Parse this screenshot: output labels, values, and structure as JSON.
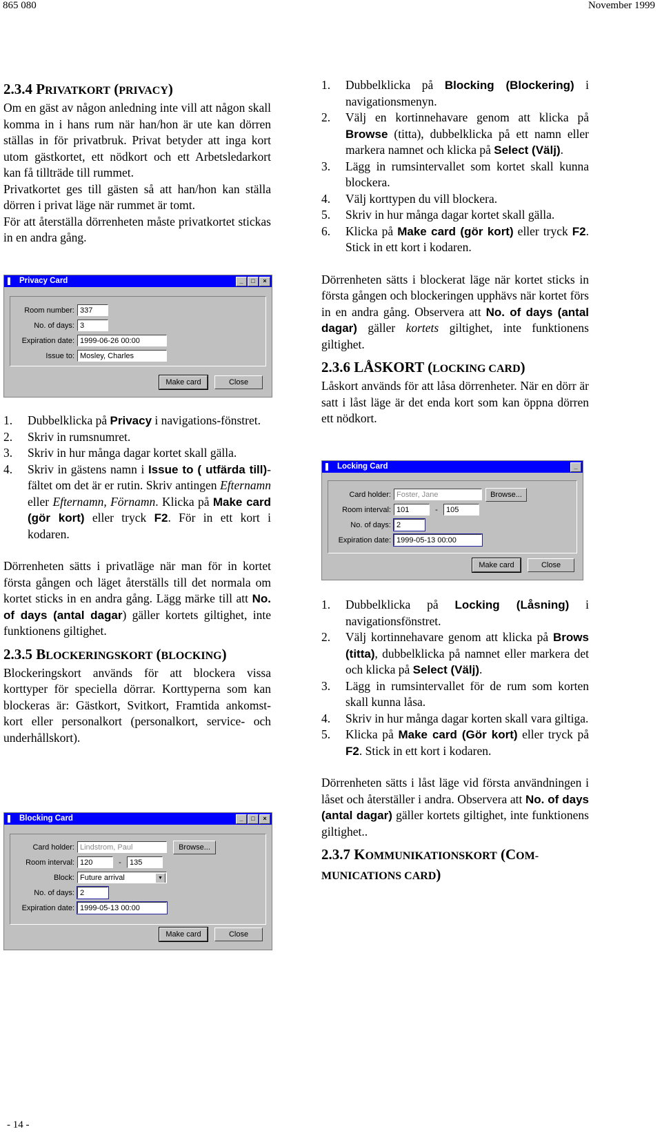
{
  "header": {
    "left": "865 080",
    "right": "November 1999"
  },
  "footer": {
    "page": "- 14 -"
  },
  "privacy_section": {
    "heading_num": "2.3.4 ",
    "heading_big1": "P",
    "heading_small1": "RIVATKORT",
    "heading_paren_open": " (",
    "heading_small2": "PRIVACY",
    "heading_paren_close": ")",
    "para1": "Om en gäst av någon anledning inte vill att någon skall komma in i hans rum när han/hon är ute kan dörren ställas in för privatbruk. Privat betyder att inga kort utom gästkortet, ett nödkort och ett Arbetsledarkort kan få tillträde till rummet.",
    "para2": "Privatkortet ges till gästen så att han/hon kan ställa dörren i privat läge när rummet är tomt.",
    "para3": "För att återställa dörrenheten måste privatkortet stickas in en andra gång.",
    "steps": [
      {
        "n": "1.",
        "a": "Dubbelklicka på ",
        "b": "Privacy",
        "c": " i navigations-fönstret."
      },
      {
        "n": "2.",
        "a": "Skriv in rumsnumret."
      },
      {
        "n": "3.",
        "a": "Skriv in hur många dagar kortet skall gälla."
      },
      {
        "n": "4.",
        "a": "Skriv in gästens namn i ",
        "b": "Issue to ( utfärda till)",
        "c": "-fältet om det är er rutin. Skriv antingen ",
        "i1": "Efternamn",
        "d": " eller ",
        "i2": "Efternamn, Förnamn",
        "e": ". Klicka på ",
        "f": "Make card (gör kort)",
        "g": " eller tryck ",
        "h": "F2",
        "j": ". För in ett kort i kodaren."
      }
    ],
    "note_a": "Dörrenheten sätts i privatläge när man för in kortet första gången och läget återställs till det normala om kortet sticks in en andra gång. Lägg märke till att ",
    "note_b": "No. of days (antal dagar",
    "note_c": ") gäller kortets giltighet, inte funktionens giltighet."
  },
  "privacy_dialog": {
    "title": "Privacy Card",
    "fields": {
      "room_number_label": "Room number:",
      "room_number": "337",
      "days_label": "No. of days:",
      "days": "3",
      "expiration_label": "Expiration date:",
      "expiration": "1999-06-26 00:00",
      "issue_label": "Issue to:",
      "issue": "Mosley, Charles"
    },
    "make_card": "Make card",
    "close": "Close"
  },
  "blocking_section": {
    "heading_num": "2.3.5 ",
    "heading_big1": "B",
    "heading_small1": "LOCKERINGSKORT",
    "heading_paren_open": " (",
    "heading_small2": "BLOCKING",
    "heading_paren_close": ")",
    "para": "Blockeringskort används för att blockera vissa korttyper för speciella dörrar. Korttyperna som kan blockeras är: Gästkort, Svitkort, Framtida ankomst-kort eller personalkort (personalkort, service- och underhållskort).",
    "steps": [
      {
        "n": "1.",
        "a": "Dubbelklicka på ",
        "b": "Blocking (Blockering)",
        "c": " i navigationsmenyn."
      },
      {
        "n": "2.",
        "a": "Välj en kortinnehavare genom att klicka på ",
        "b": "Browse",
        "c": " (titta), dubbelklicka på ett namn eller markera namnet och klicka på ",
        "d": "Select (Välj)",
        "e": "."
      },
      {
        "n": "3.",
        "a": "Lägg in rumsintervallet som kortet skall kunna blockera."
      },
      {
        "n": "4.",
        "a": "Välj korttypen du vill blockera."
      },
      {
        "n": "5.",
        "a": "Skriv in hur många dagar kortet skall gälla."
      },
      {
        "n": "6.",
        "a": "Klicka på ",
        "b": "Make card (gör kort)",
        "c": " eller tryck ",
        "d": "F2",
        "e": ". Stick in ett kort i kodaren."
      }
    ],
    "note_a": "Dörrenheten sätts i blockerat läge när kortet sticks in första gången och blockeringen upphävs när kortet förs in en andra gång. Observera att ",
    "note_b": "No. of days (antal dagar)",
    "note_c": " gäller ",
    "note_i": "kortets",
    "note_d": " giltighet, inte funktionens giltighet."
  },
  "blocking_dialog": {
    "title": "Blocking Card",
    "fields": {
      "holder_label": "Card holder:",
      "holder": "Lindstrom, Paul",
      "interval_label": "Room interval:",
      "from": "120",
      "dash": "-",
      "to": "135",
      "block_label": "Block:",
      "block": "Future arrival",
      "days_label": "No. of days:",
      "days": "2",
      "expiration_label": "Expiration date:",
      "expiration": "1999-05-13 00:00"
    },
    "browse": "Browse...",
    "make_card": "Make card",
    "close": "Close"
  },
  "locking_section": {
    "heading_num": "2.3.6 ",
    "heading_main": "LÅSKORT",
    "heading_paren_open": " (",
    "heading_small": "LOCKING CARD",
    "heading_paren_close": ")",
    "para": "Låskort används för att låsa dörrenheter. När en dörr är satt i låst läge är det enda kort som kan öppna dörren ett nödkort.",
    "steps": [
      {
        "n": "1.",
        "a": "Dubbelklicka på ",
        "b": "Locking (Låsning)",
        "c": " i navigationsfönstret."
      },
      {
        "n": "2.",
        "a": "Välj kortinnehavare genom att klicka på ",
        "b": "Brows (titta)",
        "c": ", dubbelklicka på namnet eller markera det och klicka på ",
        "d": "Select (Välj)",
        "e": "."
      },
      {
        "n": "3.",
        "a": "Lägg in rumsintervallet för de rum som korten skall kunna låsa."
      },
      {
        "n": "4.",
        "a": "Skriv in hur många dagar korten skall vara giltiga."
      },
      {
        "n": "5.",
        "a": "Klicka på ",
        "b": "Make card (Gör kort)",
        "c": " eller tryck på ",
        "d": "F2",
        "e": ". Stick in ett kort i kodaren."
      }
    ],
    "note_a": "Dörrenheten sätts i låst läge vid första användningen i låset och återställer i andra. Observera att ",
    "note_b": "No. of days (antal dagar)",
    "note_c": " gäller kortets giltighet, inte funktionens giltighet.."
  },
  "locking_dialog": {
    "title": "Locking Card",
    "fields": {
      "holder_label": "Card holder:",
      "holder": "Foster, Jane",
      "interval_label": "Room interval:",
      "from": "101",
      "dash": "-",
      "to": "105",
      "days_label": "No. of days:",
      "days": "2",
      "expiration_label": "Expiration date:",
      "expiration": "1999-05-13 00:00"
    },
    "browse": "Browse...",
    "make_card": "Make card",
    "close": "Close"
  },
  "communications_section": {
    "heading_num": "2.3.7 ",
    "heading_big1": "K",
    "heading_small1": "OMMUNIKATIONSKORT",
    "heading_paren_open": " (",
    "heading_big2": "C",
    "heading_small2": "OM-",
    "heading_line2": "MUNICATIONS CARD",
    "heading_paren_close": ")"
  }
}
